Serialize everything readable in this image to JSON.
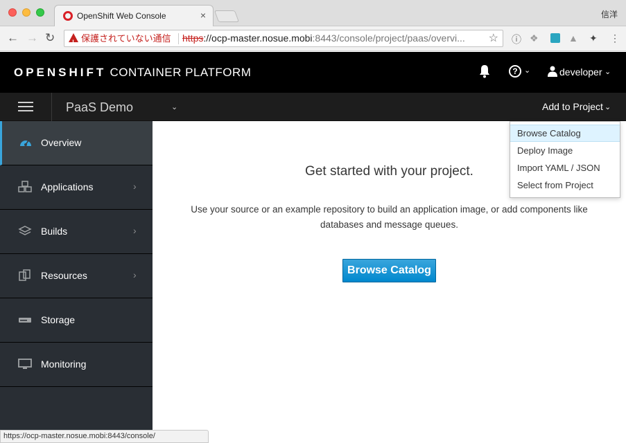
{
  "browser": {
    "tab_title": "OpenShift Web Console",
    "profile_name": "信洋",
    "security_warning": "保護されていない通信",
    "url_scheme": "https",
    "url_host": "://ocp-master.nosue.mobi",
    "url_path": ":8443/console/project/paas/overvi...",
    "status_url": "https://ocp-master.nosue.mobi:8443/console/"
  },
  "header": {
    "brand_bold": "OPENSHIFT",
    "brand_light": "CONTAINER PLATFORM",
    "user_name": "developer"
  },
  "project_bar": {
    "project_name": "PaaS Demo",
    "add_to_project": "Add to Project"
  },
  "sidebar": {
    "items": [
      {
        "label": "Overview"
      },
      {
        "label": "Applications"
      },
      {
        "label": "Builds"
      },
      {
        "label": "Resources"
      },
      {
        "label": "Storage"
      },
      {
        "label": "Monitoring"
      }
    ]
  },
  "main": {
    "title": "Get started with your project.",
    "description": "Use your source or an example repository to build an application image, or add components like databases and message queues.",
    "button_label": "Browse Catalog"
  },
  "dropdown": {
    "items": [
      {
        "label": "Browse Catalog"
      },
      {
        "label": "Deploy Image"
      },
      {
        "label": "Import YAML / JSON"
      },
      {
        "label": "Select from Project"
      }
    ]
  },
  "colors": {
    "accent": "#39a5dc",
    "primary_button": "#0088ce",
    "sidebar_bg": "#292e34",
    "header_bg": "#000000"
  }
}
